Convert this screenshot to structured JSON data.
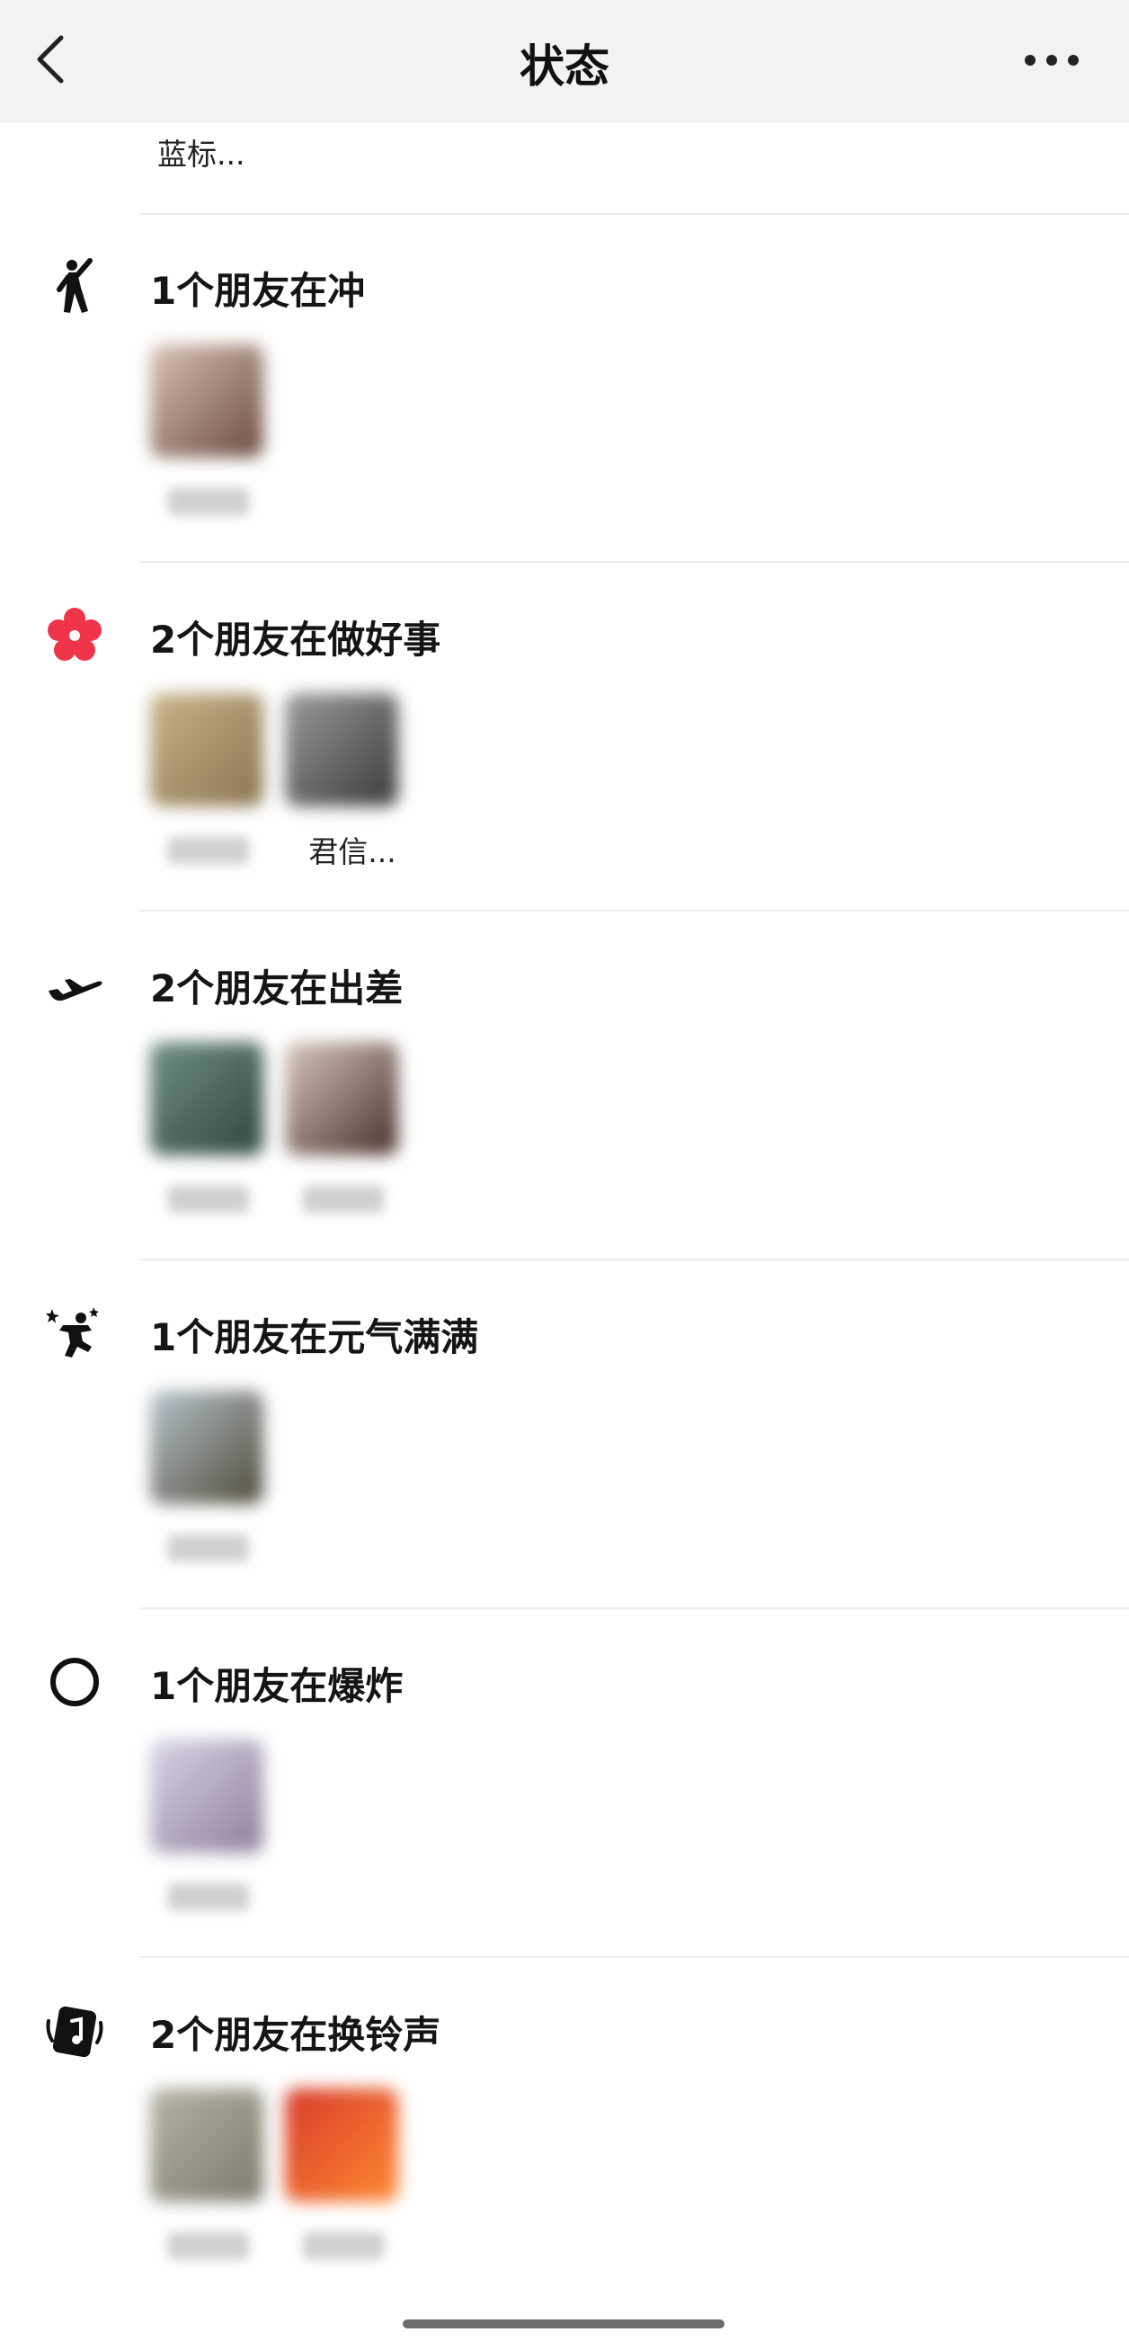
{
  "header": {
    "title": "状态",
    "back_icon": "chevron-left-icon",
    "more_icon": "ellipsis-icon"
  },
  "previous_section": {
    "friend_name": "蓝标..."
  },
  "sections": [
    {
      "icon": "cheering-person-icon",
      "title": "1个朋友在冲",
      "friends": [
        {
          "name": "",
          "avatar_colors": [
            "#d9c2b4",
            "#6b4b3f"
          ]
        }
      ]
    },
    {
      "icon": "red-flower-icon",
      "icon_color": "#f0354b",
      "title": "2个朋友在做好事",
      "friends": [
        {
          "name": "",
          "avatar_colors": [
            "#c9b48a",
            "#8a7350"
          ]
        },
        {
          "name": "君信...",
          "avatar_colors": [
            "#9b9b9b",
            "#3a3a3a"
          ]
        }
      ]
    },
    {
      "icon": "airplane-icon",
      "title": "2个朋友在出差",
      "friends": [
        {
          "name": "",
          "avatar_colors": [
            "#6f8f86",
            "#2f4540"
          ]
        },
        {
          "name": "",
          "avatar_colors": [
            "#d8c8be",
            "#4a2f2a"
          ]
        }
      ]
    },
    {
      "icon": "energetic-person-icon",
      "title": "1个朋友在元气满满",
      "friends": [
        {
          "name": "",
          "avatar_colors": [
            "#b8c4cc",
            "#4f4a3a"
          ]
        }
      ]
    },
    {
      "icon": "ring-icon",
      "title": "1个朋友在爆炸",
      "friends": [
        {
          "name": "",
          "avatar_colors": [
            "#d9d4e6",
            "#8f7f9d"
          ]
        }
      ]
    },
    {
      "icon": "music-card-icon",
      "title": "2个朋友在换铃声",
      "friends": [
        {
          "name": "",
          "avatar_colors": [
            "#b7b3a7",
            "#7c786b"
          ]
        },
        {
          "name": "",
          "avatar_colors": [
            "#d73a2a",
            "#ff8a32"
          ]
        }
      ]
    }
  ]
}
